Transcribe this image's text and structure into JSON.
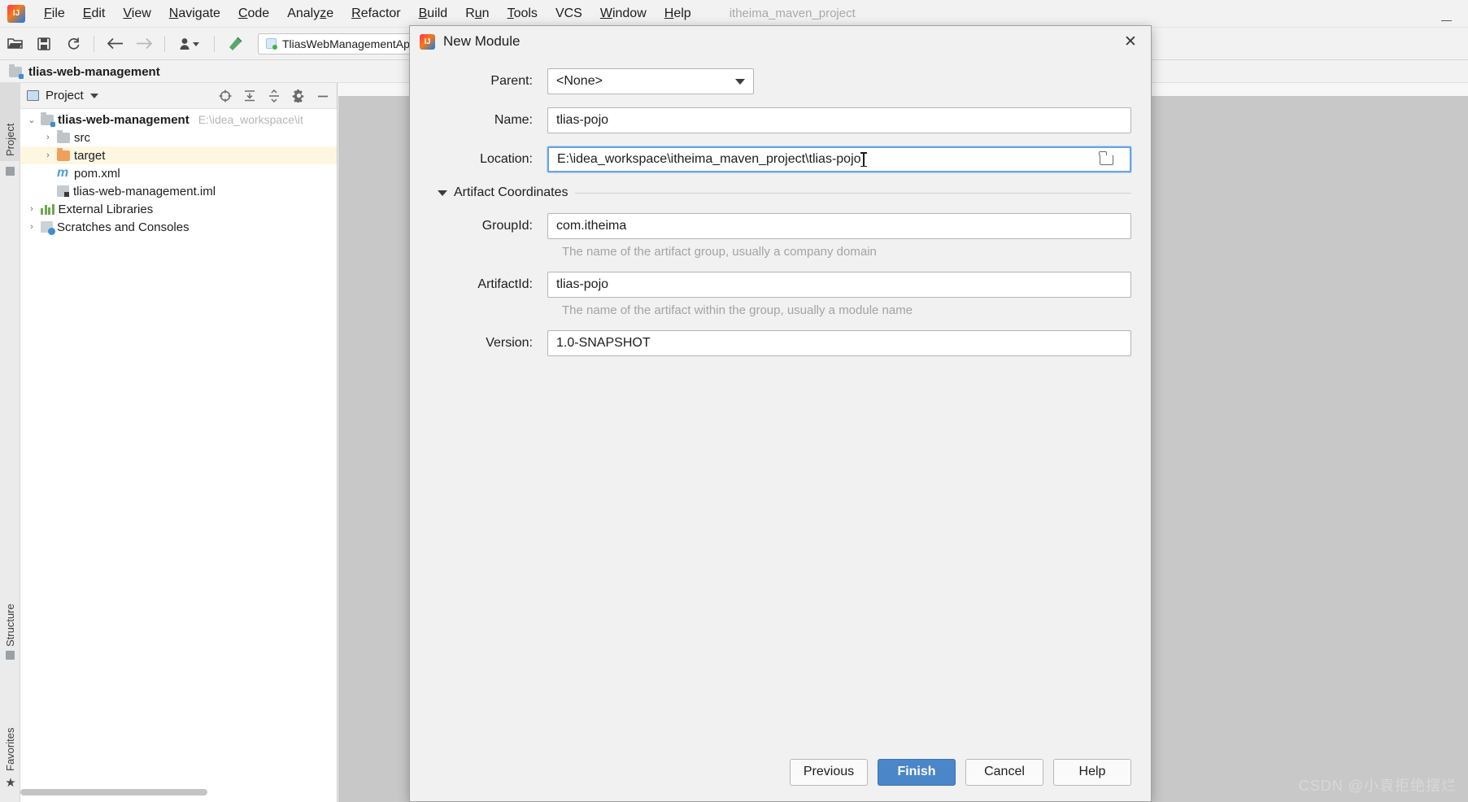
{
  "window": {
    "project_title": "itheima_maven_project",
    "minimize_label": "—"
  },
  "menubar": {
    "logo": "intellij-idea-logo",
    "items": [
      {
        "label": "File",
        "mnemonic": "F"
      },
      {
        "label": "Edit",
        "mnemonic": "E"
      },
      {
        "label": "View",
        "mnemonic": "V"
      },
      {
        "label": "Navigate",
        "mnemonic": "N"
      },
      {
        "label": "Code",
        "mnemonic": "C"
      },
      {
        "label": "Analyze",
        "mnemonic": "z"
      },
      {
        "label": "Refactor",
        "mnemonic": "R"
      },
      {
        "label": "Build",
        "mnemonic": "B"
      },
      {
        "label": "Run",
        "mnemonic": "u"
      },
      {
        "label": "Tools",
        "mnemonic": "T"
      },
      {
        "label": "VCS",
        "mnemonic": "V"
      },
      {
        "label": "Window",
        "mnemonic": "W"
      },
      {
        "label": "Help",
        "mnemonic": "H"
      }
    ]
  },
  "toolbar": {
    "open_icon": "open-folder-icon",
    "save_icon": "save-icon",
    "sync_icon": "refresh-icon",
    "back_icon": "arrow-left-icon",
    "forward_icon": "arrow-right-icon",
    "profile_icon": "user-dropdown-icon",
    "build_icon": "hammer-icon",
    "run_config": "TliasWebManagementApp"
  },
  "project_header": {
    "breadcrumb": "tlias-web-management",
    "icon": "module-folder-icon"
  },
  "left_rail": {
    "project_tab": "Project",
    "structure_tab": "Structure",
    "favorites_tab": "Favorites"
  },
  "project_panel": {
    "title": "Project",
    "actions": {
      "locate_icon": "crosshair-target-icon",
      "expand_icon": "expand-all-icon",
      "collapse_icon": "collapse-all-icon",
      "settings_icon": "gear-icon",
      "hide_icon": "minimize-icon"
    },
    "tree": [
      {
        "label": "tlias-web-management",
        "path": "E:\\idea_workspace\\it",
        "icon": "module-folder-icon",
        "arrow": "expanded",
        "indent": 0,
        "bold": true,
        "highlighted": false
      },
      {
        "label": "src",
        "path": "",
        "icon": "folder-icon",
        "arrow": "collapsed",
        "indent": 1,
        "bold": false,
        "highlighted": false
      },
      {
        "label": "target",
        "path": "",
        "icon": "folder-orange-icon",
        "arrow": "collapsed",
        "indent": 1,
        "bold": false,
        "highlighted": true
      },
      {
        "label": "pom.xml",
        "path": "",
        "icon": "maven-m-icon",
        "arrow": "none",
        "indent": 1,
        "bold": false,
        "highlighted": false
      },
      {
        "label": "tlias-web-management.iml",
        "path": "",
        "icon": "iml-file-icon",
        "arrow": "none",
        "indent": 1,
        "bold": false,
        "highlighted": false
      },
      {
        "label": "External Libraries",
        "path": "",
        "icon": "libraries-icon",
        "arrow": "collapsed",
        "indent": 0,
        "bold": false,
        "highlighted": false
      },
      {
        "label": "Scratches and Consoles",
        "path": "",
        "icon": "scratches-icon",
        "arrow": "collapsed",
        "indent": 0,
        "bold": false,
        "highlighted": false
      }
    ]
  },
  "dialog": {
    "title": "New Module",
    "icon": "intellij-idea-logo",
    "close_label": "✕",
    "fields": {
      "parent_label": "Parent:",
      "parent_value": "<None>",
      "name_label": "Name:",
      "name_value": "tlias-pojo",
      "location_label": "Location:",
      "location_value": "E:\\idea_workspace\\itheima_maven_project\\tlias-pojo",
      "browse_icon": "folder-browse-icon"
    },
    "section": {
      "artifact_coordinates_label": "Artifact Coordinates",
      "toggle_icon": "triangle-down-icon",
      "groupid_label": "GroupId:",
      "groupid_value": "com.itheima",
      "groupid_hint": "The name of the artifact group, usually a company domain",
      "artifactid_label": "ArtifactId:",
      "artifactid_value": "tlias-pojo",
      "artifactid_hint": "The name of the artifact within the group, usually a module name",
      "version_label": "Version:",
      "version_value": "1.0-SNAPSHOT"
    },
    "buttons": {
      "previous": "Previous",
      "finish": "Finish",
      "cancel": "Cancel",
      "help": "Help"
    },
    "accent_color": "#4a86c8",
    "focus_border_color": "#6aa2e0"
  },
  "watermark": "CSDN @小袁拒绝摆烂"
}
